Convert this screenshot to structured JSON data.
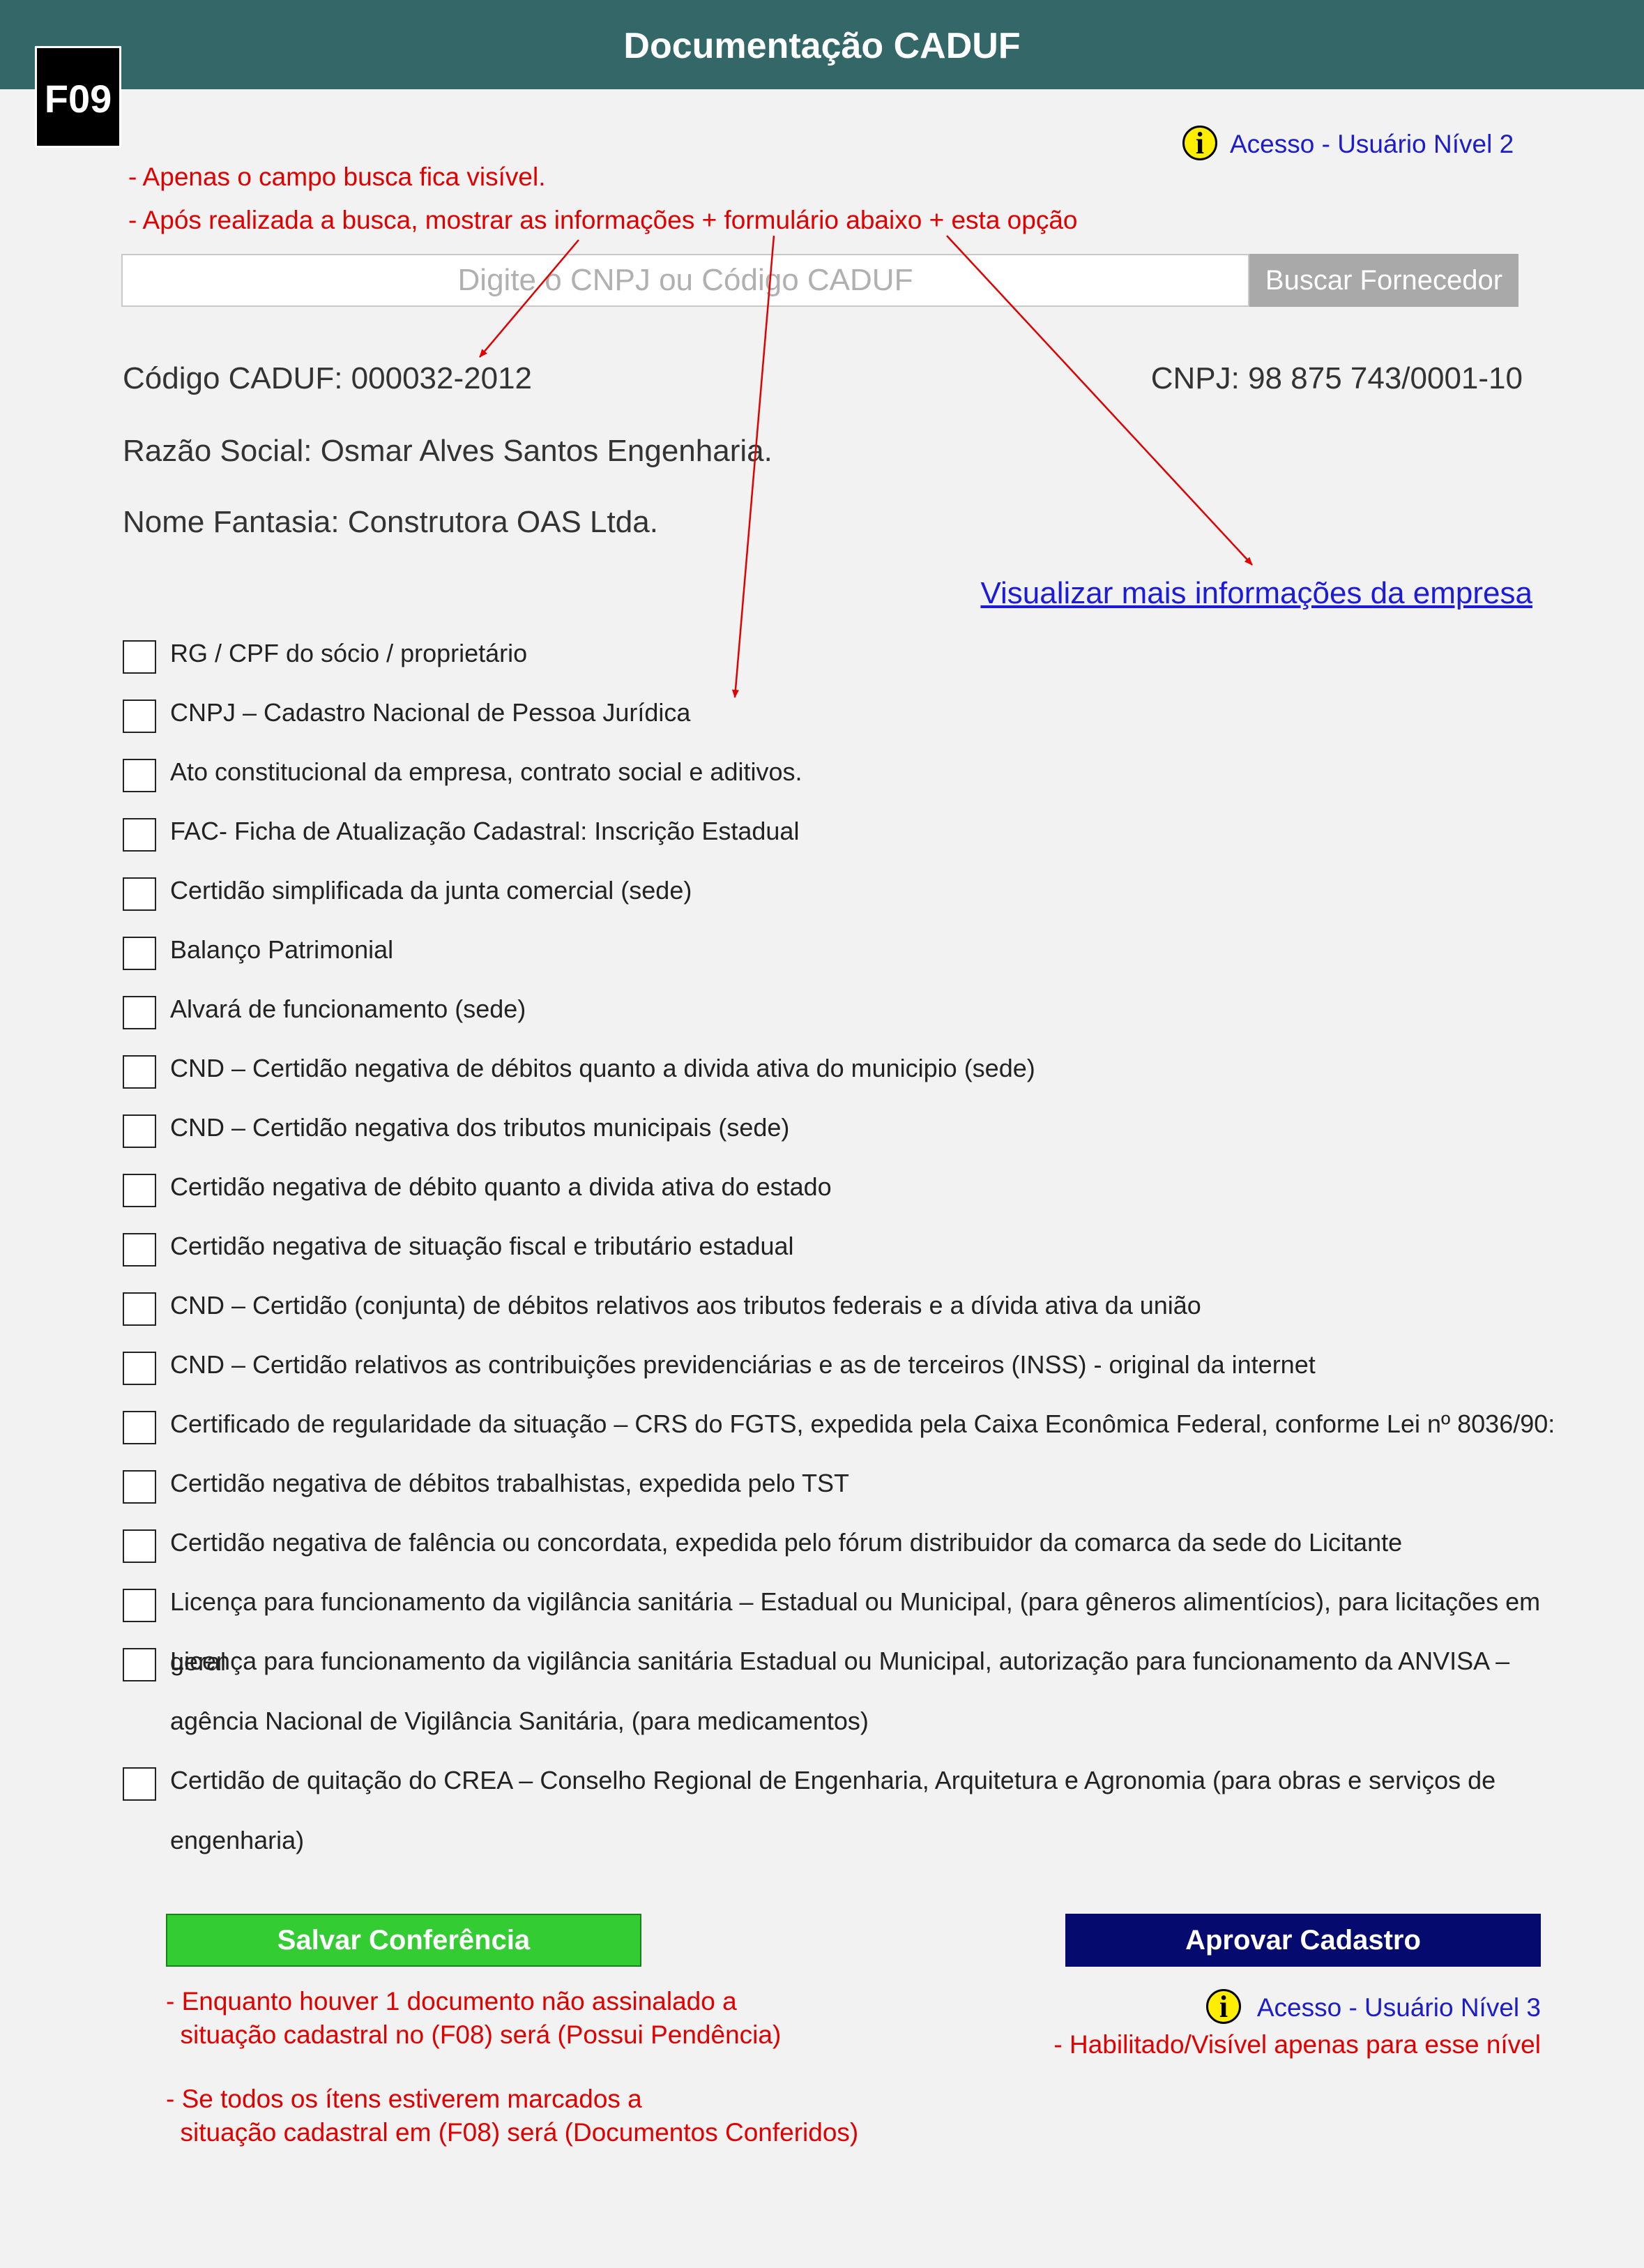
{
  "header": {
    "title": "Documentação CADUF"
  },
  "badge": {
    "label": "F09"
  },
  "top_access": {
    "icon": "info-icon",
    "label": "Acesso - Usuário Nível 2"
  },
  "top_notes": [
    "- Apenas o campo busca fica visível.",
    "- Após realizada a busca, mostrar as informações + formulário abaixo + esta opção"
  ],
  "search": {
    "placeholder": "Digite o CNPJ ou Código CADUF",
    "button_label": "Buscar Fornecedor"
  },
  "company": {
    "codigo": "Código CADUF: 000032-2012",
    "cnpj": "CNPJ: 98 875 743/0001-10",
    "razao_social": "Razão Social: Osmar Alves Santos Engenharia.",
    "nome_fantasia": "Nome Fantasia: Construtora OAS Ltda.",
    "more_info_link": "Visualizar mais informações da empresa"
  },
  "documents": [
    "RG / CPF do sócio / proprietário",
    "CNPJ – Cadastro Nacional de Pessoa Jurídica",
    "Ato constitucional da empresa, contrato social e aditivos.",
    "FAC- Ficha de Atualização Cadastral: Inscrição Estadual",
    "Certidão simplificada da junta comercial (sede)",
    "Balanço Patrimonial",
    "Alvará de funcionamento (sede)",
    "CND – Certidão negativa de débitos quanto a divida ativa do municipio (sede)",
    "CND – Certidão negativa dos tributos municipais (sede)",
    "Certidão negativa de débito quanto a divida ativa do estado",
    "Certidão negativa de situação fiscal e tributário estadual",
    "CND – Certidão (conjunta) de débitos relativos aos tributos federais e a dívida ativa da união",
    "CND – Certidão relativos as contribuições previdenciárias e as de terceiros (INSS) - original da internet",
    "Certificado de regularidade da situação – CRS do FGTS, expedida pela Caixa Econômica Federal, conforme Lei nº 8036/90:",
    "Certidão negativa de débitos trabalhistas, expedida pelo TST",
    "Certidão negativa de falência ou concordata, expedida pelo fórum distribuidor da comarca da sede do Licitante",
    "Licença para funcionamento da vigilância sanitária – Estadual ou Municipal, (para gêneros alimentícios), para licitações em geral",
    "Licença para funcionamento da vigilância sanitária Estadual ou Municipal, autorização para funcionamento da ANVISA – agência Nacional de Vigilância Sanitária, (para medicamentos)",
    "Certidão de quitação do CREA – Conselho Regional de Engenharia, Arquitetura e Agronomia (para obras e serviços de engenharia)"
  ],
  "buttons": {
    "save_label": "Salvar Conferência",
    "approve_label": "Aprovar Cadastro"
  },
  "bottom_notes": {
    "save_note_1": "- Enquanto houver 1 documento não assinalado a\n  situação cadastral no (F08) será (Possui Pendência)",
    "save_note_2": "- Se todos os ítens estiverem marcados a\n  situação cadastral em (F08) será (Documentos Conferidos)",
    "approve_access": "Acesso - Usuário Nível 3",
    "approve_note": "- Habilitado/Visível apenas para esse nível"
  },
  "colors": {
    "header_bg": "#346767",
    "note_red": "#e00000",
    "link_blue": "#1c1cd8",
    "save_green": "#33cc33",
    "approve_navy": "#050a6e"
  }
}
